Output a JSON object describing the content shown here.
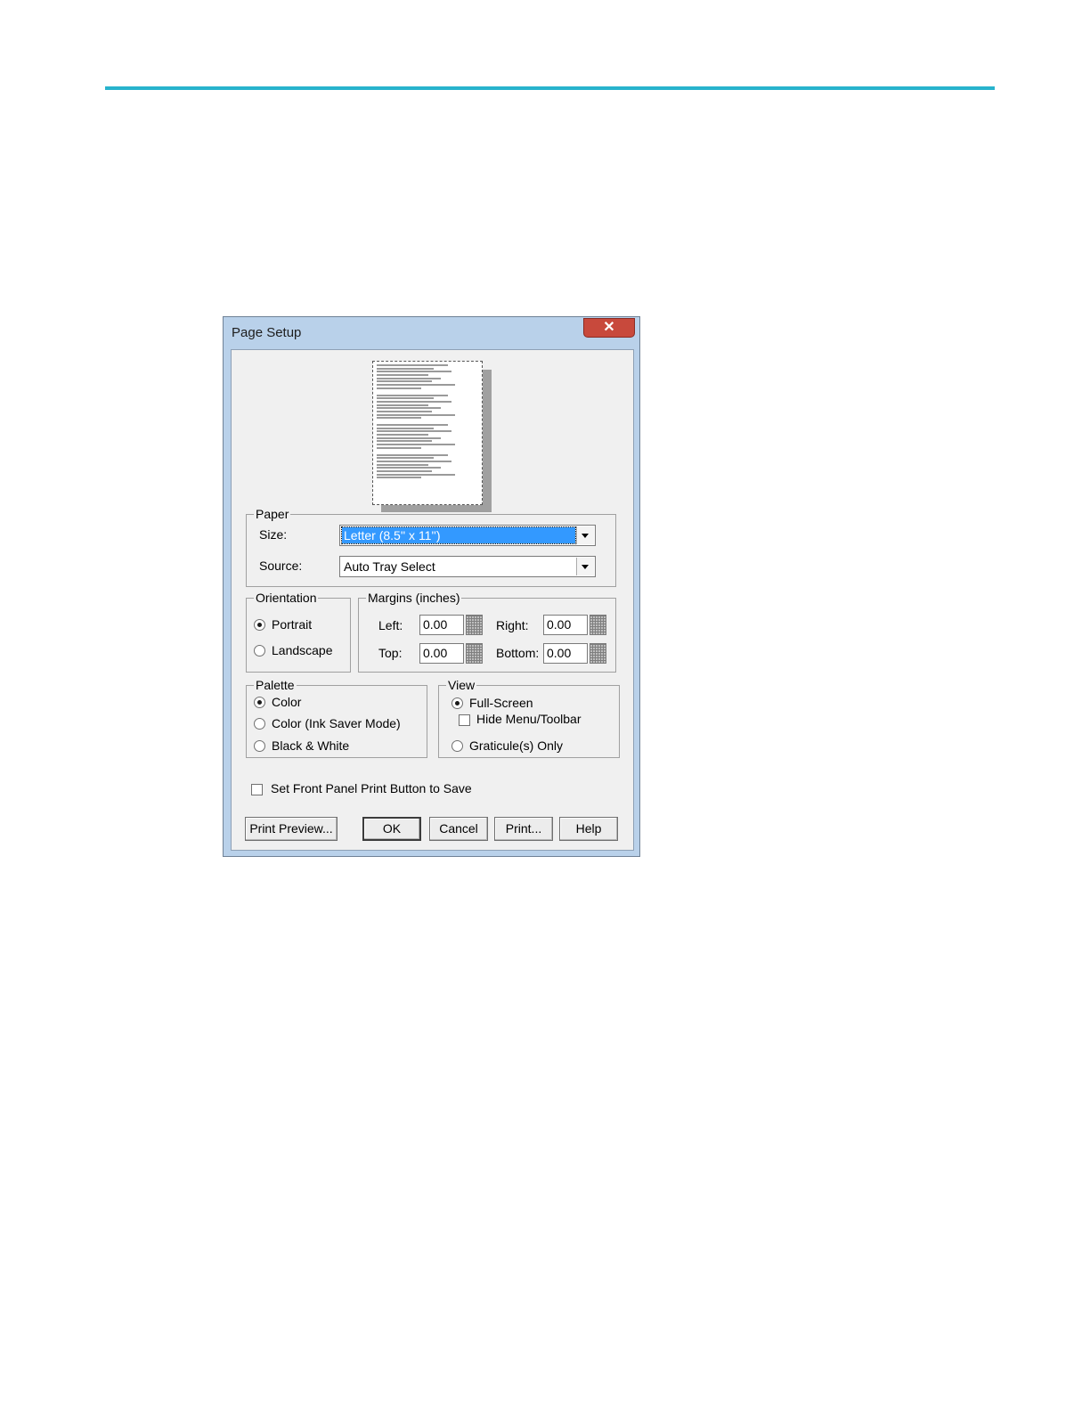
{
  "dialog": {
    "title": "Page Setup",
    "close_glyph": "✕"
  },
  "paper": {
    "group_label": "Paper",
    "size_label": "Size:",
    "size_value": "Letter (8.5'' x 11'')",
    "source_label": "Source:",
    "source_value": "Auto Tray Select"
  },
  "orientation": {
    "group_label": "Orientation",
    "portrait": "Portrait",
    "landscape": "Landscape",
    "selected": "Portrait"
  },
  "margins": {
    "group_label": "Margins (inches)",
    "left_label": "Left:",
    "left_value": "0.00",
    "right_label": "Right:",
    "right_value": "0.00",
    "top_label": "Top:",
    "top_value": "0.00",
    "bottom_label": "Bottom:",
    "bottom_value": "0.00"
  },
  "palette": {
    "group_label": "Palette",
    "color": "Color",
    "ink_saver": "Color (Ink Saver Mode)",
    "bw": "Black & White",
    "selected": "Color"
  },
  "view": {
    "group_label": "View",
    "full_screen": "Full-Screen",
    "hide_menu": "Hide Menu/Toolbar",
    "graticule": "Graticule(s) Only",
    "selected": "Full-Screen"
  },
  "front_panel_checkbox": "Set Front Panel Print Button to Save",
  "buttons": {
    "print_preview": "Print Preview...",
    "ok": "OK",
    "cancel": "Cancel",
    "print": "Print...",
    "help": "Help"
  },
  "colors": {
    "rule": "#28b3cd",
    "selection": "#3399ff",
    "close_button": "#c8493c"
  }
}
